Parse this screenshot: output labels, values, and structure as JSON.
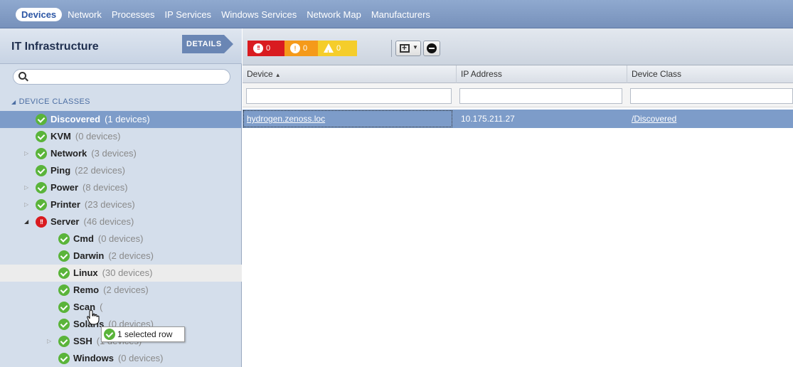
{
  "nav": {
    "items": [
      "Devices",
      "Network",
      "Processes",
      "IP Services",
      "Windows Services",
      "Network Map",
      "Manufacturers"
    ]
  },
  "left": {
    "title": "IT Infrastructure",
    "details_label": "DETAILS",
    "search": {
      "value": "",
      "placeholder": ""
    },
    "section_label": "DEVICE CLASSES",
    "tree": [
      {
        "name": "Discovered",
        "count": "(1 devices)",
        "status": "ok",
        "level": 0,
        "expander": "none",
        "state": "selected"
      },
      {
        "name": "KVM",
        "count": "(0 devices)",
        "status": "ok",
        "level": 0,
        "expander": "none",
        "state": ""
      },
      {
        "name": "Network",
        "count": "(3 devices)",
        "status": "ok",
        "level": 0,
        "expander": "collapsed",
        "state": ""
      },
      {
        "name": "Ping",
        "count": "(22 devices)",
        "status": "ok",
        "level": 0,
        "expander": "none",
        "state": ""
      },
      {
        "name": "Power",
        "count": "(8 devices)",
        "status": "ok",
        "level": 0,
        "expander": "collapsed",
        "state": ""
      },
      {
        "name": "Printer",
        "count": "(23 devices)",
        "status": "ok",
        "level": 0,
        "expander": "collapsed",
        "state": ""
      },
      {
        "name": "Server",
        "count": "(46 devices)",
        "status": "crit",
        "level": 0,
        "expander": "expanded",
        "state": ""
      },
      {
        "name": "Cmd",
        "count": "(0 devices)",
        "status": "ok",
        "level": 1,
        "expander": "none",
        "state": ""
      },
      {
        "name": "Darwin",
        "count": "(2 devices)",
        "status": "ok",
        "level": 1,
        "expander": "none",
        "state": ""
      },
      {
        "name": "Linux",
        "count": "(30 devices)",
        "status": "ok",
        "level": 1,
        "expander": "none",
        "state": "hover"
      },
      {
        "name": "Remo",
        "count": "(2 devices)",
        "status": "ok",
        "level": 1,
        "expander": "none",
        "state": ""
      },
      {
        "name": "Scan",
        "count": "(",
        "status": "ok",
        "level": 1,
        "expander": "none",
        "state": ""
      },
      {
        "name": "Solaris",
        "count": "(0 devices)",
        "status": "ok",
        "level": 1,
        "expander": "none",
        "state": ""
      },
      {
        "name": "SSH",
        "count": "(1 devices)",
        "status": "ok",
        "level": 1,
        "expander": "collapsed",
        "state": ""
      },
      {
        "name": "Windows",
        "count": "(0 devices)",
        "status": "ok",
        "level": 1,
        "expander": "none",
        "state": ""
      }
    ],
    "tooltip": "1 selected row"
  },
  "toolbar": {
    "events": {
      "critical": "0",
      "error": "0",
      "warning": "0"
    },
    "colors": {
      "critical": "#d91b20",
      "error": "#f59a1a",
      "warning": "#f5cd2b"
    }
  },
  "grid": {
    "columns": [
      "Device",
      "IP Address",
      "Device Class"
    ],
    "sort_column": "Device",
    "sort_direction": "ascending",
    "filters": [
      "",
      "",
      ""
    ],
    "rows": [
      {
        "device": "hydrogen.zenoss.loc",
        "ip": "10.175.211.27",
        "device_class": "/Discovered"
      }
    ]
  },
  "colors": {
    "selection": "#7d9cc9",
    "nav": "#8fa9cf"
  }
}
